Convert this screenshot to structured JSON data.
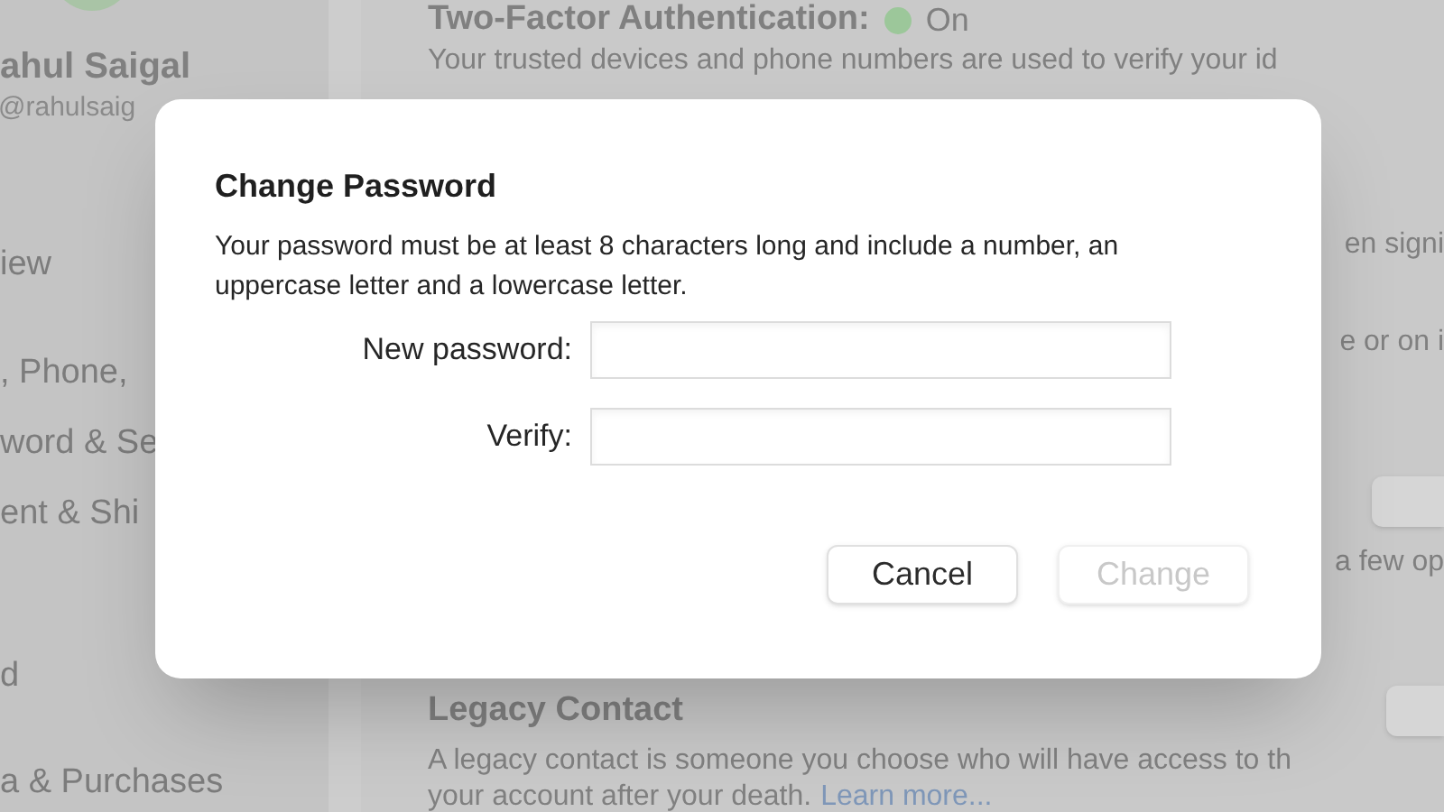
{
  "sidebar": {
    "user_name": "ahul Saigal",
    "user_email": "@rahulsaig",
    "items": [
      {
        "label": "iew"
      },
      {
        "label": ", Phone,"
      },
      {
        "label": "word & Se"
      },
      {
        "label": "ent & Shi"
      },
      {
        "label": "d"
      },
      {
        "label": "a & Purchases"
      }
    ]
  },
  "content": {
    "two_factor": {
      "title": "Two-Factor Authentication:",
      "on": true,
      "status": "On"
    },
    "two_factor_text": "Your trusted devices and phone numbers are used to verify your id",
    "fragments": [
      "en signi",
      "e or on i",
      "a few op"
    ],
    "legacy_title": "Legacy Contact",
    "legacy_text": "A legacy contact is someone you choose who will have access to th",
    "legacy_text_2": "your account after your death.",
    "legacy_link": "Learn more..."
  },
  "dialog": {
    "title": "Change Password",
    "message": "Your password must be at least 8 characters long and include a number, an uppercase letter and a lowercase letter.",
    "fields": [
      {
        "label": "New password:"
      },
      {
        "label": "Verify:"
      }
    ],
    "buttons": [
      {
        "label": "Cancel",
        "disabled": false
      },
      {
        "label": "Change",
        "disabled": true
      }
    ]
  }
}
